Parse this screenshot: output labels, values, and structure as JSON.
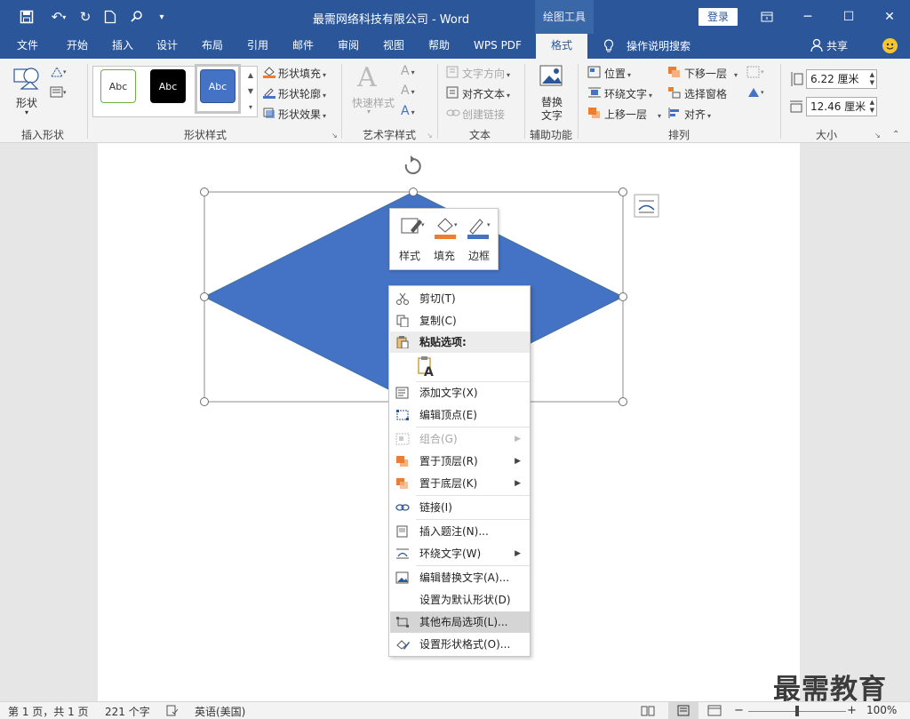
{
  "titlebar": {
    "title": "最需网络科技有限公司 - Word",
    "context_tab": "绘图工具",
    "login": "登录"
  },
  "tabs": [
    "文件",
    "开始",
    "插入",
    "设计",
    "布局",
    "引用",
    "邮件",
    "审阅",
    "视图",
    "帮助",
    "WPS PDF",
    "格式"
  ],
  "active_tab": "格式",
  "tell_me": "操作说明搜索",
  "share": "共享",
  "ribbon": {
    "insert_shapes": {
      "shapes_btn": "形状",
      "group": "插入形状"
    },
    "shape_styles": {
      "presets": [
        "Abc",
        "Abc",
        "Abc"
      ],
      "fill": "形状填充",
      "outline": "形状轮廓",
      "effects": "形状效果",
      "group": "形状样式"
    },
    "wordart": {
      "quick_styles": "快速样式",
      "group": "艺术字样式"
    },
    "text": {
      "direction": "文字方向",
      "align": "对齐文本",
      "link": "创建链接",
      "group": "文本"
    },
    "accessibility": {
      "alt_text_l1": "替换",
      "alt_text_l2": "文字",
      "group": "辅助功能"
    },
    "arrange": {
      "position": "位置",
      "wrap": "环绕文字",
      "forward": "上移一层",
      "backward": "下移一层",
      "pane": "选择窗格",
      "align": "对齐",
      "group": "排列"
    },
    "size": {
      "height": "6.22 厘米",
      "width": "12.46 厘米",
      "group": "大小"
    }
  },
  "mini_toolbar": {
    "style": "样式",
    "fill": "填充",
    "border": "边框"
  },
  "context_menu": {
    "cut": "剪切(T)",
    "copy": "复制(C)",
    "paste_header": "粘贴选项:",
    "add_text": "添加文字(X)",
    "edit_points": "编辑顶点(E)",
    "group": "组合(G)",
    "bring_front": "置于顶层(R)",
    "send_back": "置于底层(K)",
    "link": "链接(I)",
    "insert_caption": "插入题注(N)...",
    "wrap_text": "环绕文字(W)",
    "edit_alt": "编辑替换文字(A)...",
    "set_default": "设置为默认形状(D)",
    "more_layout": "其他布局选项(L)...",
    "format_shape": "设置形状格式(O)..."
  },
  "statusbar": {
    "page": "第 1 页，共 1 页",
    "words": "221 个字",
    "language": "英语(美国)",
    "zoom": "100%",
    "zoom_level": 1.0
  },
  "watermark": "最需教育",
  "colors": {
    "brand": "#2b579a",
    "shape_fill": "#4472c4",
    "fill_accent": "#ed7d31"
  }
}
